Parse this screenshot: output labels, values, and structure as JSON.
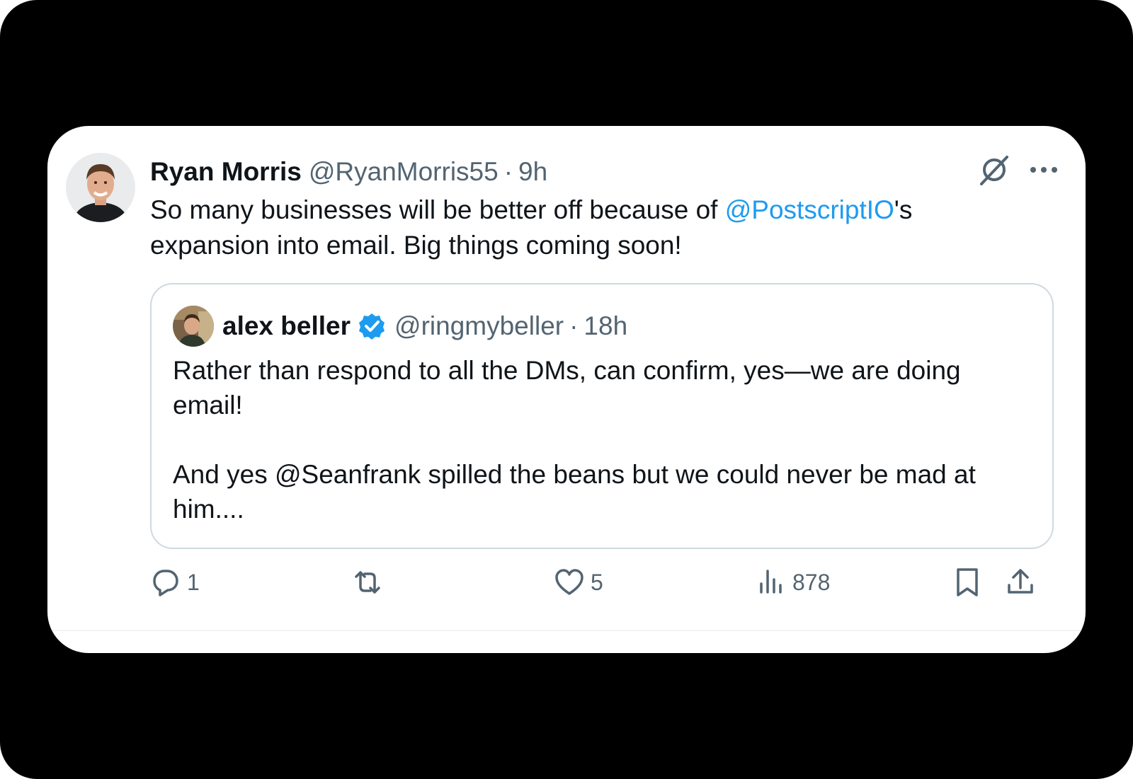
{
  "tweet": {
    "author_name": "Ryan Morris",
    "author_handle": "@RyanMorris55",
    "separator": "·",
    "time": "9h",
    "text_before": "So many businesses will be better off because of ",
    "mention": "@PostscriptIO",
    "text_after": "'s expansion into email. Big things coming soon!"
  },
  "quote": {
    "author_name": "alex beller",
    "author_handle": "@ringmybeller",
    "separator": "·",
    "time": "18h",
    "paragraph1": "Rather than respond to all the DMs, can confirm, yes—we are doing email!",
    "paragraph2": "And yes @Seanfrank spilled the beans but we could never be mad at him...."
  },
  "actions": {
    "reply_count": "1",
    "retweet_count": "",
    "like_count": "5",
    "views_count": "878"
  },
  "icons": {
    "grok": "grok-icon",
    "more": "more-icon",
    "verified": "verified-badge-icon",
    "reply": "reply-icon",
    "retweet": "retweet-icon",
    "like": "heart-icon",
    "views": "views-icon",
    "bookmark": "bookmark-icon",
    "share": "share-icon"
  },
  "colors": {
    "link": "#1d9bf0",
    "verified": "#1d9bf0",
    "secondary_text": "#536471",
    "primary_text": "#0f1419"
  }
}
